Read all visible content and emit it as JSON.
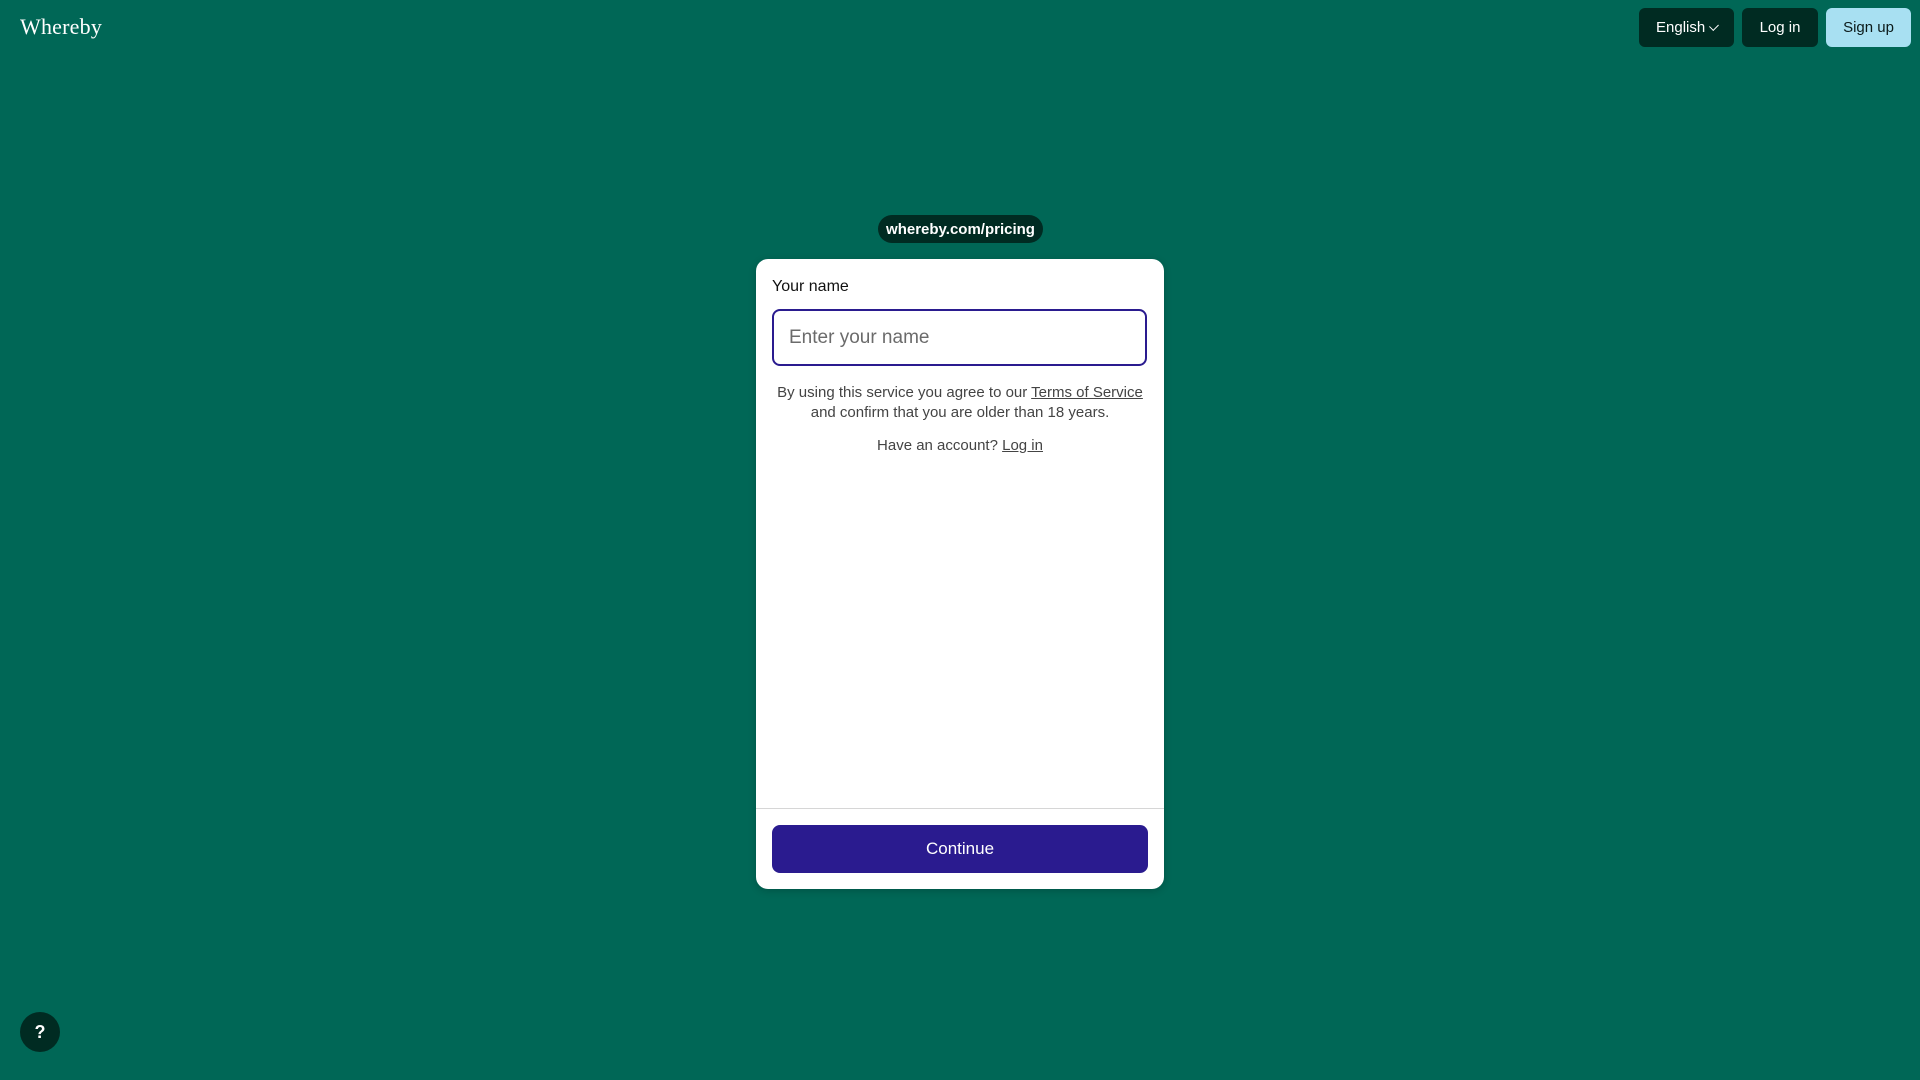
{
  "header": {
    "logo_text": "Whereby",
    "language_label": "English",
    "login_label": "Log in",
    "signup_label": "Sign up"
  },
  "room": {
    "url_label": "whereby.com/pricing"
  },
  "form": {
    "name_label": "Your name",
    "name_placeholder": "Enter your name",
    "name_value": "",
    "terms_prefix": "By using this service you agree to our ",
    "terms_link": "Terms of Service",
    "terms_suffix": "and confirm that you are older than 18 years.",
    "account_prefix": "Have an account? ",
    "account_link": "Log in",
    "continue_label": "Continue"
  },
  "help": {
    "label": "?"
  },
  "colors": {
    "background": "#006756",
    "dark": "#002b22",
    "primary": "#2a1b8f",
    "signup": "#a8e0f2"
  }
}
